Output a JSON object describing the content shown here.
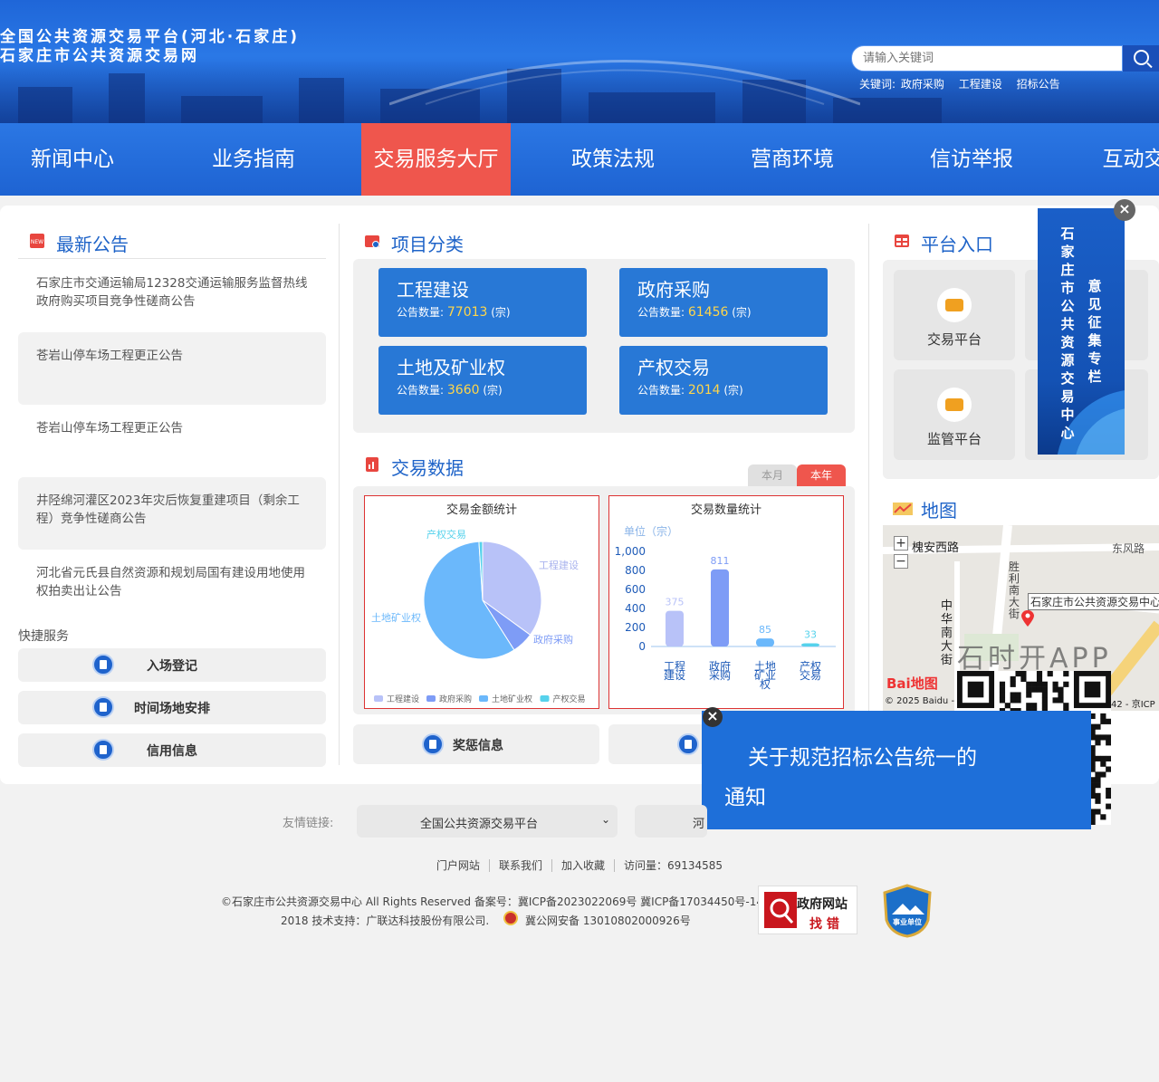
{
  "header": {
    "title_line1": "全国公共资源交易平台(河北·石家庄)",
    "title_line2": "石家庄市公共资源交易网",
    "search_placeholder": "请输入关键词",
    "keywords_label": "关键词:",
    "keywords": [
      "政府采购",
      "工程建设",
      "招标公告"
    ]
  },
  "nav": {
    "items": [
      "新闻中心",
      "业务指南",
      "交易服务大厅",
      "政策法规",
      "营商环境",
      "信访举报",
      "互动交"
    ],
    "active_index": 2,
    "active_color": "#ef564d"
  },
  "notices": {
    "title": "最新公告",
    "items": [
      "石家庄市交通运输局12328交通运输服务监督热线政府购买项目竞争性磋商公告",
      "苍岩山停车场工程更正公告",
      "苍岩山停车场工程更正公告",
      "井陉绵河灌区2023年灾后恢复重建项目（剩余工程）竞争性磋商公告",
      "河北省元氏县自然资源和规划局国有建设用地使用权拍卖出让公告"
    ]
  },
  "quick": {
    "title": "快捷服务",
    "items": [
      "入场登记",
      "时间场地安排",
      "信用信息"
    ]
  },
  "projects": {
    "title": "项目分类",
    "count_label": "公告数量:",
    "unit": "(宗)",
    "items": [
      {
        "name": "工程建设",
        "count": "77013"
      },
      {
        "name": "政府采购",
        "count": "61456"
      },
      {
        "name": "土地及矿业权",
        "count": "3660"
      },
      {
        "name": "产权交易",
        "count": "2014"
      }
    ]
  },
  "trade": {
    "title": "交易数据",
    "tab_month": "本月",
    "tab_year": "本年"
  },
  "chart_data": [
    {
      "type": "pie",
      "title": "交易金额统计",
      "labels": [
        "工程建设",
        "政府采购",
        "土地矿业权",
        "产权交易"
      ],
      "values": [
        35,
        6,
        58,
        1
      ],
      "colors": [
        "#b8c2f8",
        "#7e9cf6",
        "#6bb8fb",
        "#56d2ec"
      ],
      "legend": "bottom"
    },
    {
      "type": "bar",
      "title": "交易数量统计",
      "ylabel": "单位（宗）",
      "categories": [
        "工程建设",
        "政府采购",
        "土地矿业权",
        "产权交易"
      ],
      "category_lines": [
        [
          "工程",
          "建设"
        ],
        [
          "政府",
          "采购"
        ],
        [
          "土地",
          "矿业",
          "权"
        ],
        [
          "产权",
          "交易"
        ]
      ],
      "values": [
        375,
        811,
        85,
        33
      ],
      "ylim": [
        0,
        1000
      ],
      "yticks": [
        "1,000",
        "800",
        "600",
        "400",
        "200",
        "0"
      ],
      "colors": [
        "#b8c2f8",
        "#7e9cf6",
        "#6bb8fb",
        "#56d2ec"
      ]
    }
  ],
  "bottom_buttons": [
    "奖惩信息",
    ""
  ],
  "platform": {
    "title": "平台入口",
    "items": [
      "交易平台",
      "监管平台"
    ]
  },
  "side_banner": {
    "col1": "石家庄市公共资源交易中心",
    "col2": "意见征集专栏"
  },
  "map": {
    "title": "地图",
    "roads": [
      "槐安西路",
      "东风路",
      "胜利南大街",
      "中华南大街"
    ],
    "poi": "石家庄市公共资源交易中心",
    "copyright": "© 2025 Baidu -",
    "copyright_right": "42 - 京ICP",
    "app_text": "石时开APP",
    "logo": "Bai地图"
  },
  "popup": {
    "text": "关于规范招标公告统一的通知"
  },
  "friend_links": {
    "label": "友情链接:",
    "select1": "全国公共资源交易平台",
    "select2": "河"
  },
  "footer": {
    "links": [
      "门户网站",
      "联系我们",
      "加入收藏",
      "访问量：69134585"
    ],
    "copyright_line1": "©石家庄市公共资源交易中心 All Rights Reserved 备案号：冀ICP备2023022069号  冀ICP备17034450号-14",
    "copyright_line2_a": "2018 技术支持：广联达科技股份有限公司.",
    "copyright_line2_b": "冀公网安备 13010802000926号",
    "badge1_top": "政府网站",
    "badge1_bottom": "找 错",
    "badge2": "事业单位"
  }
}
